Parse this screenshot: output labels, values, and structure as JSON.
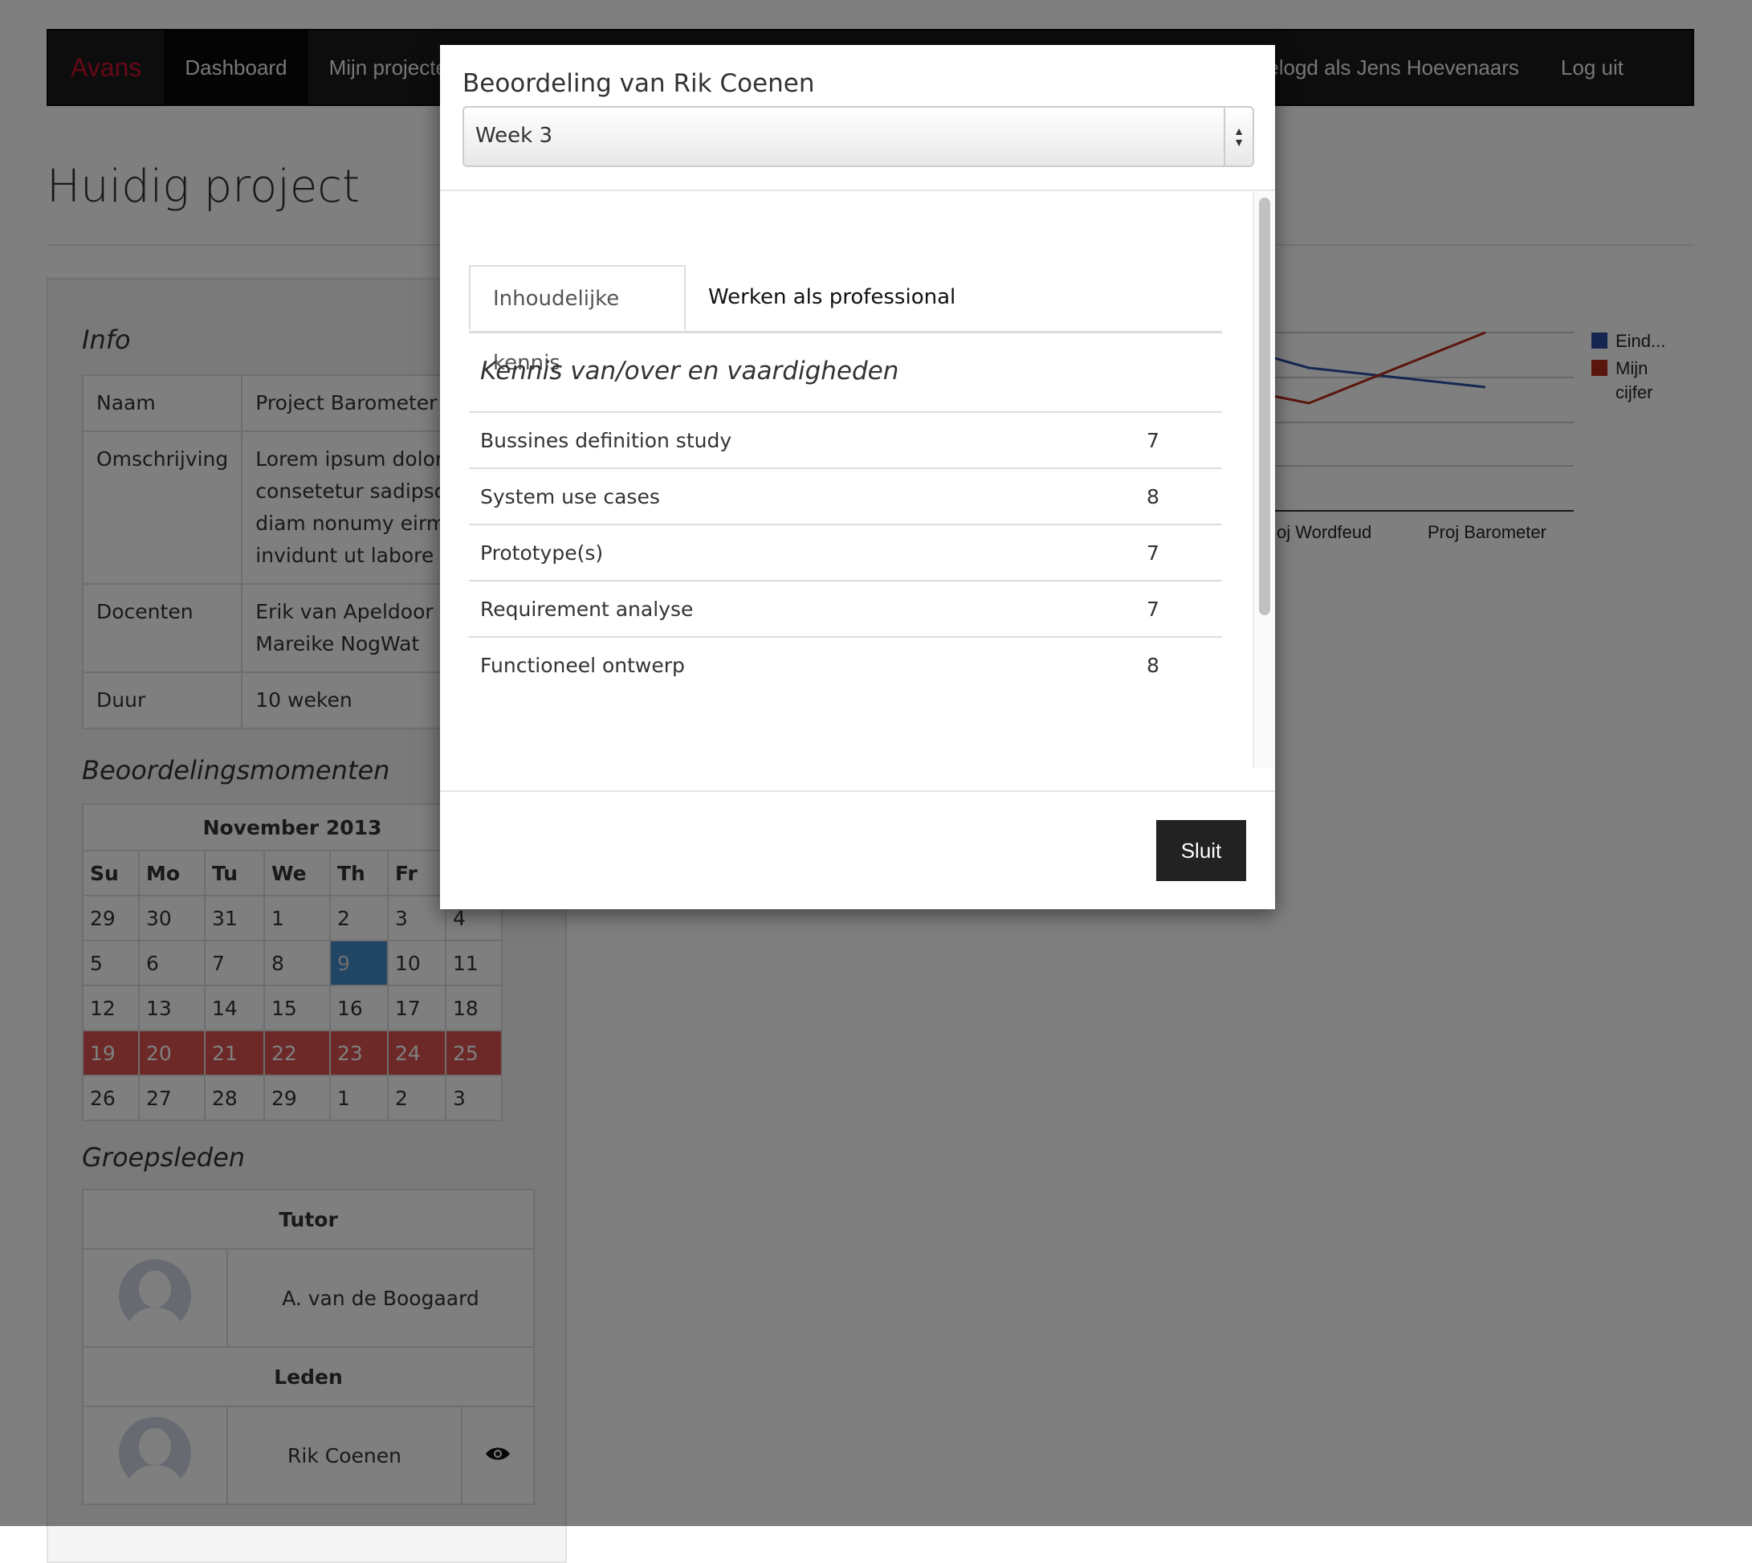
{
  "navbar": {
    "brand": "Avans",
    "links": [
      "Dashboard",
      "Mijn projecte"
    ],
    "logged_in": "gelogd als Jens Hoevenaars",
    "logout": "Log uit"
  },
  "page": {
    "title": "Huidig project",
    "info_heading": "Info",
    "info": {
      "naam_label": "Naam",
      "naam_value": "Project Barometer",
      "omschrijving_label": "Omschrijving",
      "omschrijving_lines": [
        "Lorem ipsum dolor sit a",
        "consetetur sadipscing e",
        "diam nonumy eirmod t",
        "invidunt ut labore et"
      ],
      "docenten_label": "Docenten",
      "docenten": [
        "Erik van Apeldoor",
        "Mareike NogWat"
      ],
      "duur_label": "Duur",
      "duur_value": "10 weken"
    },
    "beoordelingsmomenten_heading": "Beoordelingsmomenten",
    "calendar": {
      "month": "November 2013",
      "days": [
        "Su",
        "Mo",
        "Tu",
        "We",
        "Th",
        "Fr"
      ],
      "weeks": [
        [
          "29",
          "30",
          "31",
          "1",
          "2",
          "3",
          "4"
        ],
        [
          "5",
          "6",
          "7",
          "8",
          "9",
          "10",
          "11"
        ],
        [
          "12",
          "13",
          "14",
          "15",
          "16",
          "17",
          "18"
        ],
        [
          "19",
          "20",
          "21",
          "22",
          "23",
          "24",
          "25"
        ],
        [
          "26",
          "27",
          "28",
          "29",
          "1",
          "2",
          "3"
        ]
      ]
    },
    "groepsleden_heading": "Groepsleden",
    "tutor_heading": "Tutor",
    "tutor_name": "A. van de Boogaard",
    "leden_heading": "Leden",
    "member_name": "Rik Coenen"
  },
  "chart_legend": [
    "Eind...",
    "Mijn",
    "cijfer"
  ],
  "chart_xlabels": [
    "oj Wordfeud",
    "Proj Barometer"
  ],
  "modal": {
    "title": "Beoordeling van Rik Coenen",
    "select_value": "Week 3",
    "tabs": [
      "Inhoudelijke kennis",
      "Werken als professional"
    ],
    "subheading": "Kennis van/over en vaardigheden",
    "grades": [
      {
        "label": "Bussines definition study",
        "value": "7"
      },
      {
        "label": "System use cases",
        "value": "8"
      },
      {
        "label": "Prototype(s)",
        "value": "7"
      },
      {
        "label": "Requirement analyse",
        "value": "7"
      },
      {
        "label": "Functioneel ontwerp",
        "value": "8"
      }
    ],
    "close_label": "Sluit"
  },
  "colors": {
    "brand": "#c8102e",
    "legend_blue": "#2b4ea2",
    "legend_red": "#b42a18",
    "today": "#428bca",
    "week_highlight": "#d9534f"
  }
}
